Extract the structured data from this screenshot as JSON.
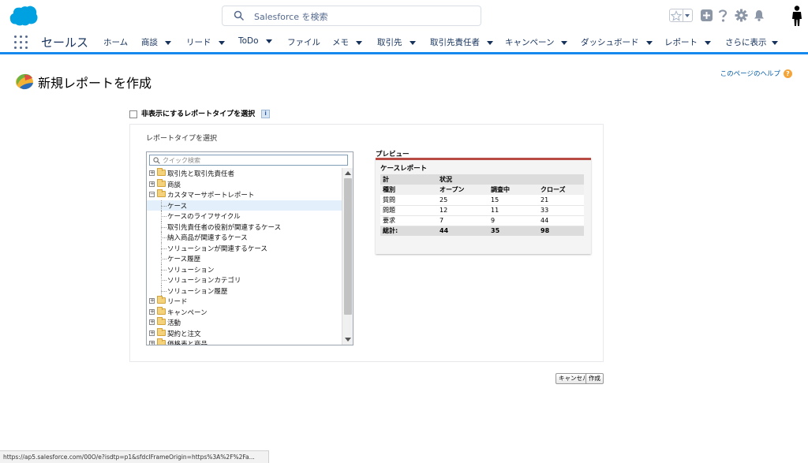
{
  "header": {
    "search_placeholder": "Salesforce を検索"
  },
  "nav": {
    "app_name": "セールス",
    "items": [
      {
        "label": "ホーム",
        "has_menu": false
      },
      {
        "label": "商談",
        "has_menu": true
      },
      {
        "label": "リード",
        "has_menu": true
      },
      {
        "label": "ToDo",
        "has_menu": true
      },
      {
        "label": "ファイル",
        "has_menu": false
      },
      {
        "label": "メモ",
        "has_menu": true
      },
      {
        "label": "取引先",
        "has_menu": true
      },
      {
        "label": "取引先責任者",
        "has_menu": true
      },
      {
        "label": "キャンペーン",
        "has_menu": true
      },
      {
        "label": "ダッシュボード",
        "has_menu": true
      },
      {
        "label": "レポート",
        "has_menu": true
      },
      {
        "label": "さらに表示",
        "has_menu": true
      }
    ]
  },
  "page": {
    "title": "新規レポートを作成",
    "help_link": "このページのヘルプ",
    "show_hidden_label": "非表示にするレポートタイプを選択",
    "select_type_label": "レポートタイプを選択",
    "quick_search_placeholder": "クイック検索",
    "preview_label": "プレビュー"
  },
  "tree": {
    "items": [
      {
        "label": "取引先と取引先責任者",
        "level": 0,
        "expanded": false
      },
      {
        "label": "商談",
        "level": 0,
        "expanded": false
      },
      {
        "label": "カスタマーサポートレポート",
        "level": 0,
        "expanded": true
      },
      {
        "label": "ケース",
        "level": 1,
        "selected": true
      },
      {
        "label": "ケースのライフサイクル",
        "level": 1
      },
      {
        "label": "取引先責任者の役割が関連するケース",
        "level": 1
      },
      {
        "label": "納入商品が関連するケース",
        "level": 1
      },
      {
        "label": "ソリューションが関連するケース",
        "level": 1
      },
      {
        "label": "ケース履歴",
        "level": 1
      },
      {
        "label": "ソリューション",
        "level": 1
      },
      {
        "label": "ソリューションカテゴリ",
        "level": 1
      },
      {
        "label": "ソリューション履歴",
        "level": 1
      },
      {
        "label": "リード",
        "level": 0,
        "expanded": false
      },
      {
        "label": "キャンペーン",
        "level": 0,
        "expanded": false
      },
      {
        "label": "活動",
        "level": 0,
        "expanded": false
      },
      {
        "label": "契約と注文",
        "level": 0,
        "expanded": false
      },
      {
        "label": "価格表と商品",
        "level": 0,
        "expanded": false
      }
    ]
  },
  "preview": {
    "title": "ケースレポート",
    "header1": [
      "計",
      "状況",
      "",
      ""
    ],
    "header2": [
      "種別",
      "オープン",
      "調査中",
      "クローズ"
    ],
    "rows": [
      [
        "質問",
        "25",
        "15",
        "21"
      ],
      [
        "問題",
        "12",
        "11",
        "33"
      ],
      [
        "要求",
        "7",
        "9",
        "44"
      ]
    ],
    "total": [
      "総計:",
      "44",
      "35",
      "98"
    ]
  },
  "buttons": {
    "cancel": "キャンセル",
    "create": "作成"
  },
  "status_url": "https://ap5.salesforce.com/00O/e?isdtp=p1&sfdcIFrameOrigin=https%3A%2F%2Fa..."
}
